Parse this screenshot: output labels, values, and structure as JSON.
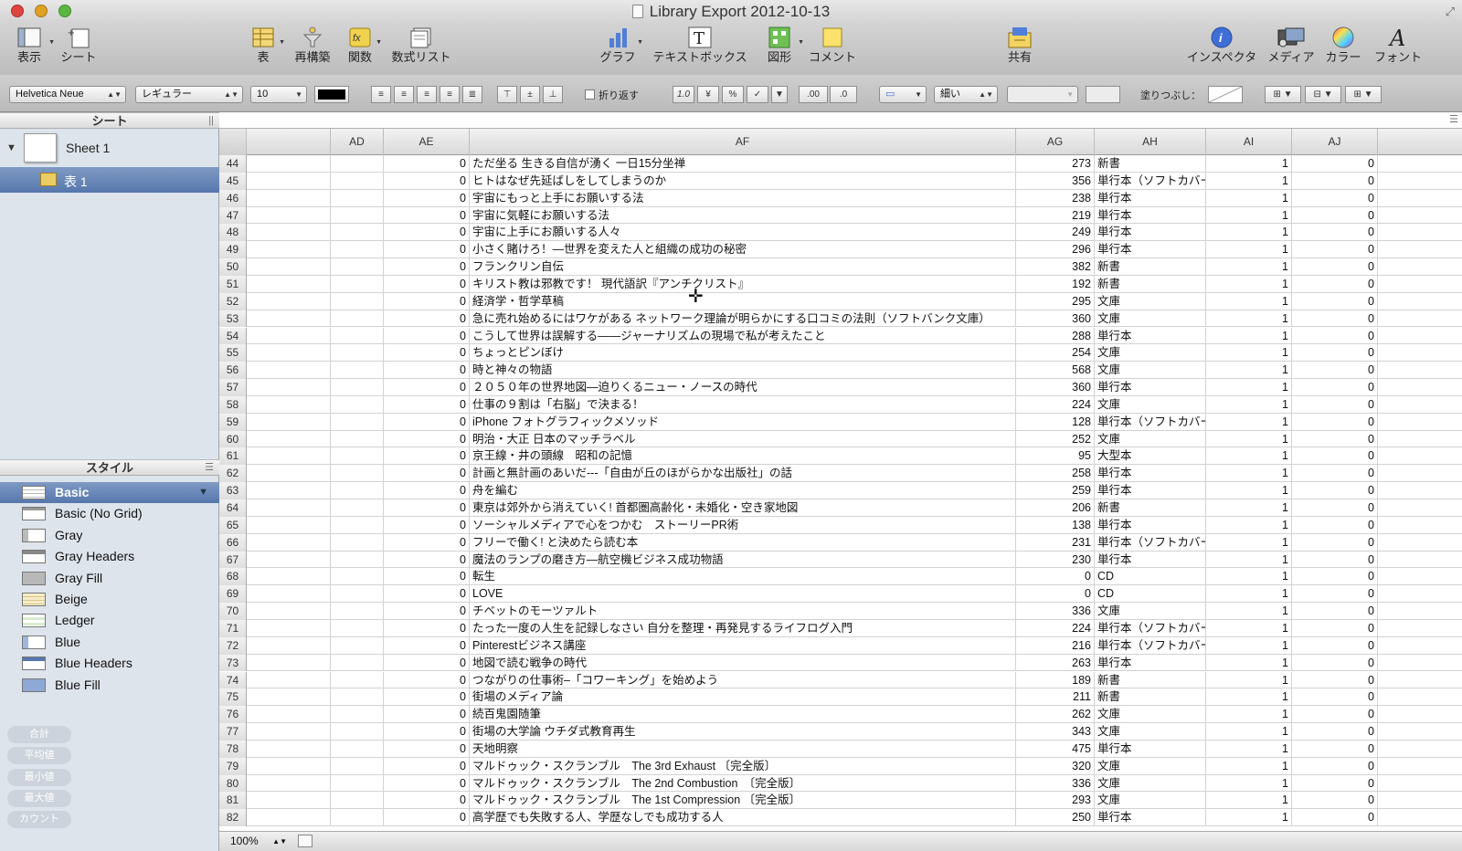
{
  "window": {
    "title": "Library Export 2012-10-13"
  },
  "toolbar": {
    "view": "表示",
    "sheet": "シート",
    "table": "表",
    "reorganize": "再構築",
    "function": "関数",
    "formula_list": "数式リスト",
    "chart": "グラフ",
    "textbox": "テキストボックス",
    "shape": "図形",
    "comment": "コメント",
    "share": "共有",
    "inspector": "インスペクタ",
    "media": "メディア",
    "color": "カラー",
    "font": "フォント"
  },
  "format_bar": {
    "font_family": "Helvetica Neue",
    "font_style": "レギュラー",
    "font_size": "10",
    "wrap_label": "折り返す",
    "decimal_a": "1.0",
    "currency": "¥",
    "percent": "%",
    "check": "✓",
    "decimals_increase": ".00",
    "decimals_decrease": ".0",
    "stroke_style": "細い",
    "fill_label": "塗りつぶし："
  },
  "sidebar": {
    "sheets_header": "シート",
    "sheet_name": "Sheet 1",
    "table_name": "表 1",
    "styles_header": "スタイル",
    "styles": [
      "Basic",
      "Basic (No Grid)",
      "Gray",
      "Gray Headers",
      "Gray Fill",
      "Beige",
      "Ledger",
      "Blue",
      "Blue Headers",
      "Blue Fill"
    ],
    "functions": [
      "合計",
      "平均値",
      "最小値",
      "最大値",
      "カウント"
    ]
  },
  "spreadsheet": {
    "columns": [
      "AD",
      "AE",
      "AF",
      "AG",
      "AH",
      "AI",
      "AJ"
    ],
    "rows": [
      {
        "n": "44",
        "ae": "0",
        "af": "ただ坐る 生きる自信が湧く 一日15分坐禅",
        "ag": "273",
        "ah": "新書",
        "ai": "1",
        "aj": "0"
      },
      {
        "n": "45",
        "ae": "0",
        "af": "ヒトはなぜ先延ばしをしてしまうのか",
        "ag": "356",
        "ah": "単行本（ソフトカバー）",
        "ai": "1",
        "aj": "0"
      },
      {
        "n": "46",
        "ae": "0",
        "af": "宇宙にもっと上手にお願いする法",
        "ag": "238",
        "ah": "単行本",
        "ai": "1",
        "aj": "0"
      },
      {
        "n": "47",
        "ae": "0",
        "af": "宇宙に気軽にお願いする法",
        "ag": "219",
        "ah": "単行本",
        "ai": "1",
        "aj": "0"
      },
      {
        "n": "48",
        "ae": "0",
        "af": "宇宙に上手にお願いする人々",
        "ag": "249",
        "ah": "単行本",
        "ai": "1",
        "aj": "0"
      },
      {
        "n": "49",
        "ae": "0",
        "af": "小さく賭けろ！―世界を変えた人と組織の成功の秘密",
        "ag": "296",
        "ah": "単行本",
        "ai": "1",
        "aj": "0"
      },
      {
        "n": "50",
        "ae": "0",
        "af": "フランクリン自伝",
        "ag": "382",
        "ah": "新書",
        "ai": "1",
        "aj": "0"
      },
      {
        "n": "51",
        "ae": "0",
        "af": "キリスト教は邪教です！ 現代語訳『アンチクリスト』",
        "ag": "192",
        "ah": "新書",
        "ai": "1",
        "aj": "0"
      },
      {
        "n": "52",
        "ae": "0",
        "af": "経済学・哲学草稿",
        "ag": "295",
        "ah": "文庫",
        "ai": "1",
        "aj": "0"
      },
      {
        "n": "53",
        "ae": "0",
        "af": "急に売れ始めるにはワケがある ネットワーク理論が明らかにする口コミの法則（ソフトバンク文庫）",
        "ag": "360",
        "ah": "文庫",
        "ai": "1",
        "aj": "0"
      },
      {
        "n": "54",
        "ae": "0",
        "af": "こうして世界は誤解する――ジャーナリズムの現場で私が考えたこと",
        "ag": "288",
        "ah": "単行本",
        "ai": "1",
        "aj": "0"
      },
      {
        "n": "55",
        "ae": "0",
        "af": "ちょっとピンぼけ",
        "ag": "254",
        "ah": "文庫",
        "ai": "1",
        "aj": "0"
      },
      {
        "n": "56",
        "ae": "0",
        "af": "時と神々の物語",
        "ag": "568",
        "ah": "文庫",
        "ai": "1",
        "aj": "0"
      },
      {
        "n": "57",
        "ae": "0",
        "af": "２０５０年の世界地図―迫りくるニュー・ノースの時代",
        "ag": "360",
        "ah": "単行本",
        "ai": "1",
        "aj": "0"
      },
      {
        "n": "58",
        "ae": "0",
        "af": "仕事の９割は「右脳」で決まる！",
        "ag": "224",
        "ah": "文庫",
        "ai": "1",
        "aj": "0"
      },
      {
        "n": "59",
        "ae": "0",
        "af": "iPhone フォトグラフィックメソッド",
        "ag": "128",
        "ah": "単行本（ソフトカバー）",
        "ai": "1",
        "aj": "0"
      },
      {
        "n": "60",
        "ae": "0",
        "af": "明治・大正 日本のマッチラベル",
        "ag": "252",
        "ah": "文庫",
        "ai": "1",
        "aj": "0"
      },
      {
        "n": "61",
        "ae": "0",
        "af": "京王線・井の頭線　昭和の記憶",
        "ag": "95",
        "ah": "大型本",
        "ai": "1",
        "aj": "0"
      },
      {
        "n": "62",
        "ae": "0",
        "af": "計画と無計画のあいだ---「自由が丘のほがらかな出版社」の話",
        "ag": "258",
        "ah": "単行本",
        "ai": "1",
        "aj": "0"
      },
      {
        "n": "63",
        "ae": "0",
        "af": "舟を編む",
        "ag": "259",
        "ah": "単行本",
        "ai": "1",
        "aj": "0"
      },
      {
        "n": "64",
        "ae": "0",
        "af": "東京は郊外から消えていく! 首都圏高齢化・未婚化・空き家地図",
        "ag": "206",
        "ah": "新書",
        "ai": "1",
        "aj": "0"
      },
      {
        "n": "65",
        "ae": "0",
        "af": "ソーシャルメディアで心をつかむ　ストーリーPR術",
        "ag": "138",
        "ah": "単行本",
        "ai": "1",
        "aj": "0"
      },
      {
        "n": "66",
        "ae": "0",
        "af": "フリーで働く! と決めたら読む本",
        "ag": "231",
        "ah": "単行本（ソフトカバー）",
        "ai": "1",
        "aj": "0"
      },
      {
        "n": "67",
        "ae": "0",
        "af": "魔法のランプの磨き方―航空機ビジネス成功物語",
        "ag": "230",
        "ah": "単行本",
        "ai": "1",
        "aj": "0"
      },
      {
        "n": "68",
        "ae": "0",
        "af": "転生",
        "ag": "0",
        "ah": "CD",
        "ai": "1",
        "aj": "0"
      },
      {
        "n": "69",
        "ae": "0",
        "af": "LOVE",
        "ag": "0",
        "ah": "CD",
        "ai": "1",
        "aj": "0"
      },
      {
        "n": "70",
        "ae": "0",
        "af": "チベットのモーツァルト",
        "ag": "336",
        "ah": "文庫",
        "ai": "1",
        "aj": "0"
      },
      {
        "n": "71",
        "ae": "0",
        "af": "たった一度の人生を記録しなさい 自分を整理・再発見するライフログ入門",
        "ag": "224",
        "ah": "単行本（ソフトカバー）",
        "ai": "1",
        "aj": "0"
      },
      {
        "n": "72",
        "ae": "0",
        "af": "Pinterestビジネス講座",
        "ag": "216",
        "ah": "単行本（ソフトカバー）",
        "ai": "1",
        "aj": "0"
      },
      {
        "n": "73",
        "ae": "0",
        "af": "地図で読む戦争の時代",
        "ag": "263",
        "ah": "単行本",
        "ai": "1",
        "aj": "0"
      },
      {
        "n": "74",
        "ae": "0",
        "af": "つながりの仕事術–「コワーキング」を始めよう",
        "ag": "189",
        "ah": "新書",
        "ai": "1",
        "aj": "0"
      },
      {
        "n": "75",
        "ae": "0",
        "af": "街場のメディア論",
        "ag": "211",
        "ah": "新書",
        "ai": "1",
        "aj": "0"
      },
      {
        "n": "76",
        "ae": "0",
        "af": "続百鬼園随筆",
        "ag": "262",
        "ah": "文庫",
        "ai": "1",
        "aj": "0"
      },
      {
        "n": "77",
        "ae": "0",
        "af": "街場の大学論 ウチダ式教育再生",
        "ag": "343",
        "ah": "文庫",
        "ai": "1",
        "aj": "0"
      },
      {
        "n": "78",
        "ae": "0",
        "af": "天地明察",
        "ag": "475",
        "ah": "単行本",
        "ai": "1",
        "aj": "0"
      },
      {
        "n": "79",
        "ae": "0",
        "af": "マルドゥック・スクランブル　The 3rd Exhaust 〔完全版〕",
        "ag": "320",
        "ah": "文庫",
        "ai": "1",
        "aj": "0"
      },
      {
        "n": "80",
        "ae": "0",
        "af": "マルドゥック・スクランブル　The 2nd Combustion　〔完全版〕",
        "ag": "336",
        "ah": "文庫",
        "ai": "1",
        "aj": "0"
      },
      {
        "n": "81",
        "ae": "0",
        "af": "マルドゥック・スクランブル　The 1st Compression 〔完全版〕",
        "ag": "293",
        "ah": "文庫",
        "ai": "1",
        "aj": "0"
      },
      {
        "n": "82",
        "ae": "0",
        "af": "高学歴でも失敗する人、学歴なしでも成功する人",
        "ag": "250",
        "ah": "単行本",
        "ai": "1",
        "aj": "0"
      }
    ]
  },
  "status": {
    "zoom": "100%"
  },
  "colors": {
    "accent": "#5677ad",
    "sidebar_bg": "#dee4ec",
    "close": "#e0443e",
    "minimize": "#dea123",
    "zoom": "#59b742"
  }
}
